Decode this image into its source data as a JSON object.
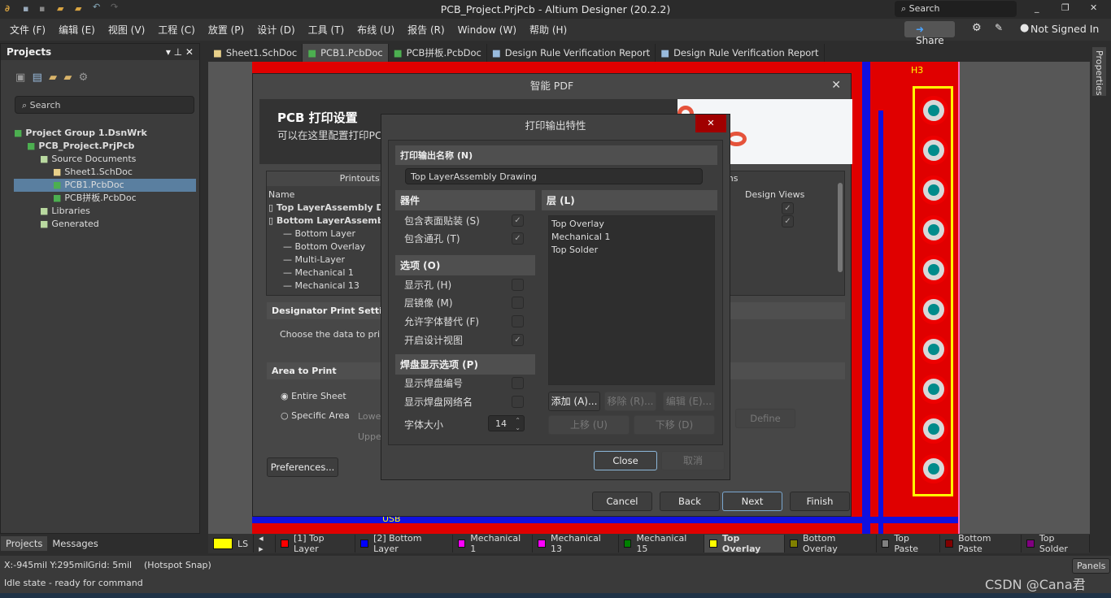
{
  "window": {
    "title": "PCB_Project.PrjPcb - Altium Designer (20.2.2)",
    "search_placeholder": "Search",
    "share": "Share",
    "user": "Not Signed In"
  },
  "menu": [
    "文件 (F)",
    "编辑 (E)",
    "视图 (V)",
    "工程 (C)",
    "放置 (P)",
    "设计 (D)",
    "工具 (T)",
    "布线 (U)",
    "报告 (R)",
    "Window (W)",
    "帮助 (H)"
  ],
  "projects_panel": {
    "title": "Projects",
    "search_placeholder": "Search",
    "tree": [
      {
        "label": "Project Group 1.DsnWrk",
        "level": 0,
        "icon": "workspace-icon"
      },
      {
        "label": "PCB_Project.PrjPcb",
        "level": 1,
        "icon": "pcb-project-icon"
      },
      {
        "label": "Source Documents",
        "level": 2,
        "icon": "folder-icon"
      },
      {
        "label": "Sheet1.SchDoc",
        "level": 3,
        "icon": "schematic-icon"
      },
      {
        "label": "PCB1.PcbDoc",
        "level": 3,
        "icon": "pcb-icon",
        "selected": true
      },
      {
        "label": "PCB拼板.PcbDoc",
        "level": 3,
        "icon": "pcb-icon"
      },
      {
        "label": "Libraries",
        "level": 2,
        "icon": "folder-icon"
      },
      {
        "label": "Generated",
        "level": 2,
        "icon": "folder-icon"
      }
    ],
    "bottom_tabs": [
      "Projects",
      "Messages"
    ]
  },
  "doc_tabs": [
    {
      "label": "Sheet1.SchDoc"
    },
    {
      "label": "PCB1.PcbDoc",
      "active": true
    },
    {
      "label": "PCB拼板.PcbDoc"
    },
    {
      "label": "Design Rule Verification Report"
    },
    {
      "label": "Design Rule Verification Report"
    }
  ],
  "right_strip": "Properties",
  "pcb": {
    "designator": "H3",
    "label_usb": "USB"
  },
  "smart_pdf": {
    "title": "智能 PDF",
    "heading": "PCB 打印设置",
    "subheading": "可以在这里配置打印PC",
    "printouts_header": "Printouts & L",
    "options_header": "ons",
    "col_name": "Name",
    "col_design_views": "Design Views",
    "rows": [
      "Top LayerAssembly Dra",
      "Bottom LayerAssembly",
      "Bottom Layer",
      "Bottom Overlay",
      "Multi-Layer",
      "Mechanical 1",
      "Mechanical 13"
    ],
    "designator_section": "Designator Print Settings",
    "designator_text": "Choose the data to print",
    "area_section": "Area to Print",
    "entire_sheet": "Entire Sheet",
    "specific_area": "Specific Area",
    "lower": "Lowe",
    "upper": "Uppe",
    "define": "Define",
    "preferences": "Preferences...",
    "cancel": "Cancel",
    "back": "Back",
    "next": "Next",
    "finish": "Finish"
  },
  "print_props": {
    "title": "打印输出特性",
    "name_section": "打印输出名称 (N)",
    "name_value": "Top LayerAssembly Drawing",
    "components_section": "器件",
    "include_smt": "包含表面贴装 (S)",
    "include_th": "包含通孔 (T)",
    "options_section": "选项 (O)",
    "show_holes": "显示孔 (H)",
    "mirror": "层镜像 (M)",
    "font_sub": "允许字体替代 (F)",
    "design_views": "开启设计视图",
    "pad_section": "焊盘显示选项 (P)",
    "pad_numbers": "显示焊盘编号",
    "pad_nets": "显示焊盘网络名",
    "font_size_label": "字体大小",
    "font_size": "14",
    "layers_section": "层 (L)",
    "layers": [
      "Top Overlay",
      "Mechanical 1",
      "Top Solder"
    ],
    "add": "添加 (A)...",
    "remove": "移除 (R)...",
    "edit": "编辑 (E)...",
    "up": "上移 (U)",
    "down": "下移 (D)",
    "close": "Close",
    "cancel": "取消",
    "checked": {
      "include_smt": true,
      "include_th": true,
      "show_holes": false,
      "mirror": false,
      "font_sub": false,
      "design_views": true,
      "pad_numbers": false,
      "pad_nets": false
    }
  },
  "layer_tabs": {
    "current": "LS",
    "tabs": [
      {
        "label": "[1] Top Layer",
        "color": "#ff0000"
      },
      {
        "label": "[2] Bottom Layer",
        "color": "#0000ff"
      },
      {
        "label": "Mechanical 1",
        "color": "#ff00ff"
      },
      {
        "label": "Mechanical 13",
        "color": "#ff00ff"
      },
      {
        "label": "Mechanical 15",
        "color": "#008000"
      },
      {
        "label": "Top Overlay",
        "color": "#ffff00",
        "active": true
      },
      {
        "label": "Bottom Overlay",
        "color": "#808000"
      },
      {
        "label": "Top Paste",
        "color": "#808080"
      },
      {
        "label": "Bottom Paste",
        "color": "#800000"
      },
      {
        "label": "Top Solder",
        "color": "#800080"
      }
    ]
  },
  "status": {
    "coords": "X:-945mil Y:295mil",
    "grid": "Grid: 5mil",
    "snap": "(Hotspot Snap)",
    "state": "Idle state - ready for command",
    "panels": "Panels",
    "watermark": "CSDN @Cana君"
  }
}
